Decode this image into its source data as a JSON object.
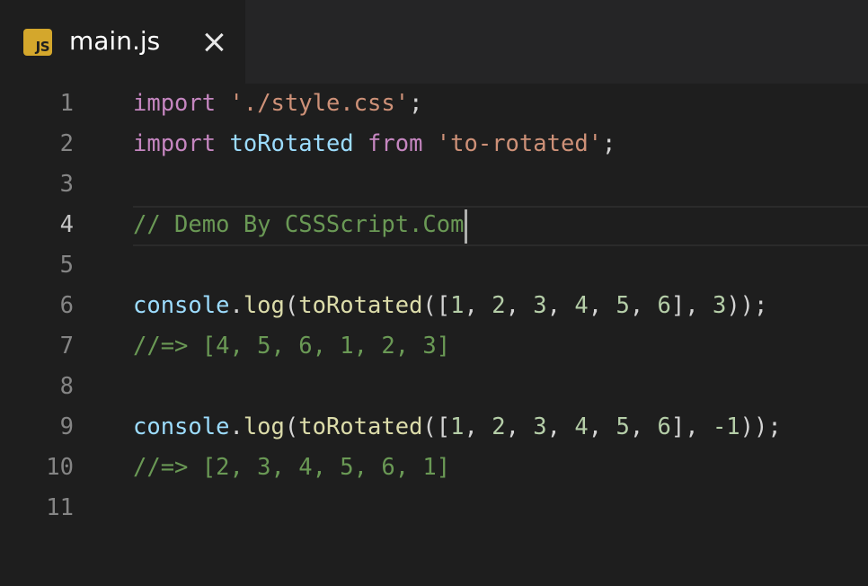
{
  "tab": {
    "icon_label": "JS",
    "title": "main.js"
  },
  "colors": {
    "background": "#1e1e1e",
    "tabbar": "#252526",
    "keyword": "#c586c0",
    "string": "#ce9178",
    "variable": "#9cdcfe",
    "function": "#dcdcaa",
    "number": "#b5cea8",
    "comment": "#6a9955",
    "punctuation": "#d4d4d4"
  },
  "editor": {
    "current_line": 4,
    "lines": [
      {
        "number": "1",
        "tokens": [
          {
            "t": "import",
            "k": "keyword"
          },
          {
            "t": " ",
            "k": "punct"
          },
          {
            "t": "'./style.css'",
            "k": "string"
          },
          {
            "t": ";",
            "k": "punct"
          }
        ]
      },
      {
        "number": "2",
        "tokens": [
          {
            "t": "import",
            "k": "keyword"
          },
          {
            "t": " ",
            "k": "punct"
          },
          {
            "t": "toRotated",
            "k": "var"
          },
          {
            "t": " ",
            "k": "punct"
          },
          {
            "t": "from",
            "k": "keyword"
          },
          {
            "t": " ",
            "k": "punct"
          },
          {
            "t": "'to-rotated'",
            "k": "string"
          },
          {
            "t": ";",
            "k": "punct"
          }
        ]
      },
      {
        "number": "3",
        "tokens": []
      },
      {
        "number": "4",
        "tokens": [
          {
            "t": "// Demo By CSSScript.Com",
            "k": "comment"
          }
        ]
      },
      {
        "number": "5",
        "tokens": []
      },
      {
        "number": "6",
        "tokens": [
          {
            "t": "console",
            "k": "var"
          },
          {
            "t": ".",
            "k": "punct"
          },
          {
            "t": "log",
            "k": "func"
          },
          {
            "t": "(",
            "k": "punct"
          },
          {
            "t": "toRotated",
            "k": "func"
          },
          {
            "t": "([",
            "k": "punct"
          },
          {
            "t": "1",
            "k": "num"
          },
          {
            "t": ", ",
            "k": "punct"
          },
          {
            "t": "2",
            "k": "num"
          },
          {
            "t": ", ",
            "k": "punct"
          },
          {
            "t": "3",
            "k": "num"
          },
          {
            "t": ", ",
            "k": "punct"
          },
          {
            "t": "4",
            "k": "num"
          },
          {
            "t": ", ",
            "k": "punct"
          },
          {
            "t": "5",
            "k": "num"
          },
          {
            "t": ", ",
            "k": "punct"
          },
          {
            "t": "6",
            "k": "num"
          },
          {
            "t": "], ",
            "k": "punct"
          },
          {
            "t": "3",
            "k": "num"
          },
          {
            "t": "));",
            "k": "punct"
          }
        ]
      },
      {
        "number": "7",
        "tokens": [
          {
            "t": "//=> [4, 5, 6, 1, 2, 3]",
            "k": "comment"
          }
        ]
      },
      {
        "number": "8",
        "tokens": []
      },
      {
        "number": "9",
        "tokens": [
          {
            "t": "console",
            "k": "var"
          },
          {
            "t": ".",
            "k": "punct"
          },
          {
            "t": "log",
            "k": "func"
          },
          {
            "t": "(",
            "k": "punct"
          },
          {
            "t": "toRotated",
            "k": "func"
          },
          {
            "t": "([",
            "k": "punct"
          },
          {
            "t": "1",
            "k": "num"
          },
          {
            "t": ", ",
            "k": "punct"
          },
          {
            "t": "2",
            "k": "num"
          },
          {
            "t": ", ",
            "k": "punct"
          },
          {
            "t": "3",
            "k": "num"
          },
          {
            "t": ", ",
            "k": "punct"
          },
          {
            "t": "4",
            "k": "num"
          },
          {
            "t": ", ",
            "k": "punct"
          },
          {
            "t": "5",
            "k": "num"
          },
          {
            "t": ", ",
            "k": "punct"
          },
          {
            "t": "6",
            "k": "num"
          },
          {
            "t": "], ",
            "k": "punct"
          },
          {
            "t": "-1",
            "k": "num"
          },
          {
            "t": "));",
            "k": "punct"
          }
        ]
      },
      {
        "number": "10",
        "tokens": [
          {
            "t": "//=> [2, 3, 4, 5, 6, 1]",
            "k": "comment"
          }
        ]
      },
      {
        "number": "11",
        "tokens": []
      }
    ]
  }
}
